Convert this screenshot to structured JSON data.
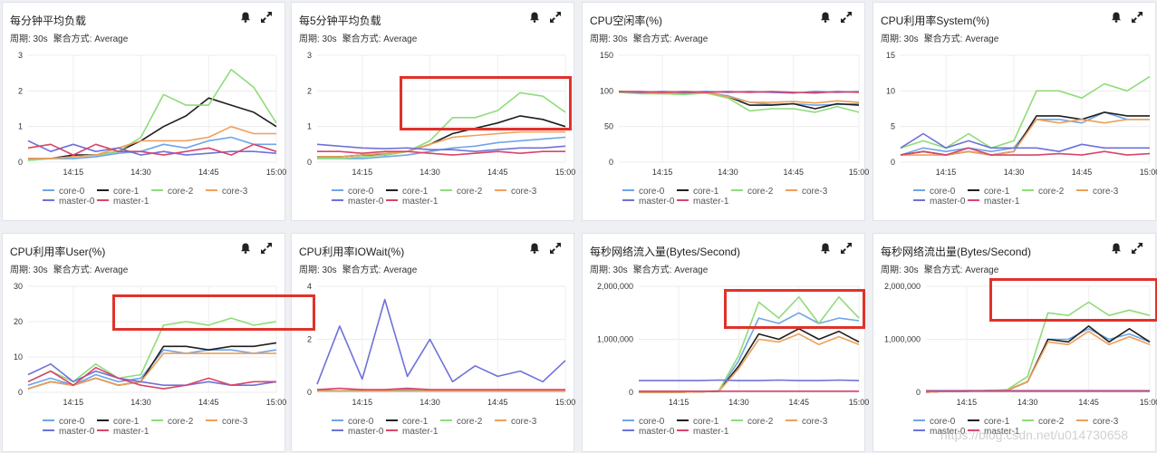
{
  "legend": [
    {
      "name": "core-0",
      "color": "#6fa5e8"
    },
    {
      "name": "core-1",
      "color": "#1f1f1f"
    },
    {
      "name": "core-2",
      "color": "#8fdc7a"
    },
    {
      "name": "core-3",
      "color": "#eea05a"
    },
    {
      "name": "master-0",
      "color": "#6e72d8"
    },
    {
      "name": "master-1",
      "color": "#d8456a"
    }
  ],
  "panels": [
    {
      "title": "每分钟平均负载",
      "period": "周期: 30s",
      "agg": "聚合方式: Average"
    },
    {
      "title": "每5分钟平均负载",
      "period": "周期: 30s",
      "agg": "聚合方式: Average"
    },
    {
      "title": "CPU空闲率(%)",
      "period": "周期: 30s",
      "agg": "聚合方式: Average"
    },
    {
      "title": "CPU利用率System(%)",
      "period": "周期: 30s",
      "agg": "聚合方式: Average"
    },
    {
      "title": "CPU利用率User(%)",
      "period": "周期: 30s",
      "agg": "聚合方式: Average"
    },
    {
      "title": "CPU利用率IOWait(%)",
      "period": "周期: 30s",
      "agg": "聚合方式: Average"
    },
    {
      "title": "每秒网络流入量(Bytes/Second)",
      "period": "周期: 30s",
      "agg": "聚合方式: Average"
    },
    {
      "title": "每秒网络流出量(Bytes/Second)",
      "period": "周期: 30s",
      "agg": "聚合方式: Average"
    }
  ],
  "chart_data": [
    {
      "type": "line",
      "x": [
        "14:05",
        "14:10",
        "14:15",
        "14:20",
        "14:25",
        "14:30",
        "14:35",
        "14:40",
        "14:45",
        "14:50",
        "14:55",
        "15:00"
      ],
      "xticks": [
        "14:15",
        "14:30",
        "14:45",
        "15:00"
      ],
      "yticks": [
        "0",
        "1",
        "2",
        "3"
      ],
      "ylim": [
        0,
        3
      ],
      "series": [
        {
          "name": "core-0",
          "values": [
            0.05,
            0.1,
            0.1,
            0.15,
            0.25,
            0.3,
            0.5,
            0.4,
            0.6,
            0.7,
            0.5,
            0.5
          ]
        },
        {
          "name": "core-1",
          "values": [
            0.1,
            0.1,
            0.2,
            0.2,
            0.3,
            0.6,
            1.0,
            1.3,
            1.8,
            1.6,
            1.4,
            1.0
          ]
        },
        {
          "name": "core-2",
          "values": [
            0.05,
            0.1,
            0.15,
            0.2,
            0.3,
            0.7,
            1.9,
            1.6,
            1.6,
            2.6,
            2.1,
            1.1
          ]
        },
        {
          "name": "core-3",
          "values": [
            0.1,
            0.1,
            0.15,
            0.2,
            0.4,
            0.6,
            0.6,
            0.6,
            0.7,
            1.0,
            0.8,
            0.8
          ]
        },
        {
          "name": "master-0",
          "values": [
            0.6,
            0.3,
            0.5,
            0.3,
            0.4,
            0.2,
            0.3,
            0.2,
            0.25,
            0.3,
            0.3,
            0.25
          ]
        },
        {
          "name": "master-1",
          "values": [
            0.4,
            0.5,
            0.2,
            0.5,
            0.3,
            0.3,
            0.2,
            0.3,
            0.4,
            0.2,
            0.5,
            0.3
          ]
        }
      ]
    },
    {
      "type": "line",
      "x": [
        "14:05",
        "14:10",
        "14:15",
        "14:20",
        "14:25",
        "14:30",
        "14:35",
        "14:40",
        "14:45",
        "14:50",
        "14:55",
        "15:00"
      ],
      "xticks": [
        "14:15",
        "14:30",
        "14:45",
        "15:00"
      ],
      "yticks": [
        "0",
        "1",
        "2",
        "3"
      ],
      "ylim": [
        0,
        3
      ],
      "series": [
        {
          "name": "core-0",
          "values": [
            0.1,
            0.1,
            0.1,
            0.15,
            0.2,
            0.3,
            0.4,
            0.45,
            0.55,
            0.6,
            0.65,
            0.7
          ]
        },
        {
          "name": "core-1",
          "values": [
            0.15,
            0.15,
            0.2,
            0.2,
            0.3,
            0.5,
            0.8,
            0.95,
            1.1,
            1.3,
            1.2,
            1.0
          ]
        },
        {
          "name": "core-2",
          "values": [
            0.1,
            0.1,
            0.15,
            0.2,
            0.3,
            0.6,
            1.25,
            1.25,
            1.45,
            1.95,
            1.85,
            1.4
          ]
        },
        {
          "name": "core-3",
          "values": [
            0.15,
            0.15,
            0.2,
            0.25,
            0.3,
            0.5,
            0.7,
            0.75,
            0.8,
            0.85,
            0.85,
            0.85
          ]
        },
        {
          "name": "master-0",
          "values": [
            0.5,
            0.45,
            0.4,
            0.38,
            0.4,
            0.35,
            0.35,
            0.3,
            0.35,
            0.4,
            0.4,
            0.45
          ]
        },
        {
          "name": "master-1",
          "values": [
            0.3,
            0.3,
            0.25,
            0.3,
            0.3,
            0.25,
            0.2,
            0.25,
            0.3,
            0.25,
            0.3,
            0.3
          ]
        }
      ]
    },
    {
      "type": "line",
      "x": [
        "14:05",
        "14:10",
        "14:15",
        "14:20",
        "14:25",
        "14:30",
        "14:35",
        "14:40",
        "14:45",
        "14:50",
        "14:55",
        "15:00"
      ],
      "xticks": [
        "14:15",
        "14:30",
        "14:45",
        "15:00"
      ],
      "yticks": [
        "0",
        "50",
        "100",
        "150"
      ],
      "ylim": [
        0,
        150
      ],
      "series": [
        {
          "name": "core-0",
          "values": [
            98,
            97,
            96,
            97,
            98,
            93,
            84,
            81,
            82,
            80,
            81,
            82
          ]
        },
        {
          "name": "core-1",
          "values": [
            99,
            98,
            97,
            98,
            97,
            92,
            80,
            80,
            82,
            75,
            82,
            80
          ]
        },
        {
          "name": "core-2",
          "values": [
            98,
            96,
            96,
            95,
            97,
            90,
            72,
            75,
            75,
            70,
            78,
            70
          ]
        },
        {
          "name": "core-3",
          "values": [
            99,
            98,
            97,
            98,
            98,
            92,
            84,
            84,
            85,
            83,
            86,
            84
          ]
        },
        {
          "name": "master-0",
          "values": [
            99,
            98,
            99,
            98,
            99,
            98,
            99,
            98,
            97,
            99,
            98,
            99
          ]
        },
        {
          "name": "master-1",
          "values": [
            99,
            99,
            98,
            99,
            98,
            99,
            98,
            99,
            98,
            97,
            99,
            98
          ]
        }
      ]
    },
    {
      "type": "line",
      "x": [
        "14:05",
        "14:10",
        "14:15",
        "14:20",
        "14:25",
        "14:30",
        "14:35",
        "14:40",
        "14:45",
        "14:50",
        "14:55",
        "15:00"
      ],
      "xticks": [
        "14:15",
        "14:30",
        "14:45",
        "15:00"
      ],
      "yticks": [
        "0",
        "5",
        "10",
        "15"
      ],
      "ylim": [
        0,
        15
      ],
      "series": [
        {
          "name": "core-0",
          "values": [
            1,
            2,
            1.5,
            2,
            1.5,
            2,
            6,
            6,
            5.5,
            7,
            6,
            6
          ]
        },
        {
          "name": "core-1",
          "values": [
            1,
            1.5,
            1,
            1.5,
            1,
            1.5,
            6.5,
            6.5,
            6,
            7,
            6.5,
            6.5
          ]
        },
        {
          "name": "core-2",
          "values": [
            2,
            3,
            2,
            4,
            2,
            3,
            10,
            10,
            9,
            11,
            10,
            12
          ]
        },
        {
          "name": "core-3",
          "values": [
            1,
            1,
            1,
            1.5,
            1,
            1.5,
            6,
            5.5,
            6,
            5.5,
            6,
            6
          ]
        },
        {
          "name": "master-0",
          "values": [
            2,
            4,
            2,
            3,
            2,
            2,
            2,
            1.5,
            2.5,
            2,
            2,
            2
          ]
        },
        {
          "name": "master-1",
          "values": [
            1,
            1.5,
            1,
            2,
            1,
            1,
            1,
            1.2,
            1,
            1.5,
            1,
            1.2
          ]
        }
      ]
    },
    {
      "type": "line",
      "x": [
        "14:05",
        "14:10",
        "14:15",
        "14:20",
        "14:25",
        "14:30",
        "14:35",
        "14:40",
        "14:45",
        "14:50",
        "14:55",
        "15:00"
      ],
      "xticks": [
        "14:15",
        "14:30",
        "14:45",
        "15:00"
      ],
      "yticks": [
        "0",
        "10",
        "20",
        "30"
      ],
      "ylim": [
        0,
        30
      ],
      "series": [
        {
          "name": "core-0",
          "values": [
            2,
            4,
            2,
            5,
            3,
            4,
            12,
            11,
            12,
            12,
            11,
            12
          ]
        },
        {
          "name": "core-1",
          "values": [
            1,
            3,
            2,
            4,
            2,
            3,
            13,
            13,
            12,
            13,
            13,
            14
          ]
        },
        {
          "name": "core-2",
          "values": [
            3,
            6,
            3,
            8,
            4,
            5,
            19,
            20,
            19,
            21,
            19,
            20
          ]
        },
        {
          "name": "core-3",
          "values": [
            1,
            3,
            2,
            4,
            2,
            3,
            11,
            11,
            11,
            11,
            11,
            11
          ]
        },
        {
          "name": "master-0",
          "values": [
            5,
            8,
            3,
            6,
            4,
            3,
            2,
            2,
            3,
            2,
            2,
            3
          ]
        },
        {
          "name": "master-1",
          "values": [
            3,
            6,
            2,
            7,
            4,
            2,
            1,
            2,
            4,
            2,
            3,
            3
          ]
        }
      ]
    },
    {
      "type": "line",
      "x": [
        "14:05",
        "14:10",
        "14:15",
        "14:20",
        "14:25",
        "14:30",
        "14:35",
        "14:40",
        "14:45",
        "14:50",
        "14:55",
        "15:00"
      ],
      "xticks": [
        "14:15",
        "14:30",
        "14:45",
        "15:00"
      ],
      "yticks": [
        "0",
        "2",
        "4"
      ],
      "ylim": [
        0,
        4
      ],
      "series": [
        {
          "name": "core-0",
          "values": [
            0.1,
            0.05,
            0.1,
            0.05,
            0.1,
            0.05,
            0.05,
            0.05,
            0.05,
            0.05,
            0.05,
            0.05
          ]
        },
        {
          "name": "core-1",
          "values": [
            0.05,
            0.05,
            0.05,
            0.05,
            0.05,
            0.05,
            0.05,
            0.05,
            0.05,
            0.05,
            0.05,
            0.05
          ]
        },
        {
          "name": "core-2",
          "values": [
            0.05,
            0.05,
            0.05,
            0.05,
            0.05,
            0.05,
            0.05,
            0.05,
            0.05,
            0.05,
            0.05,
            0.05
          ]
        },
        {
          "name": "core-3",
          "values": [
            0.05,
            0.05,
            0.05,
            0.05,
            0.05,
            0.05,
            0.05,
            0.05,
            0.05,
            0.05,
            0.05,
            0.05
          ]
        },
        {
          "name": "master-0",
          "values": [
            0.3,
            2.5,
            0.5,
            3.5,
            0.6,
            2.0,
            0.4,
            1.0,
            0.6,
            0.8,
            0.4,
            1.2
          ]
        },
        {
          "name": "master-1",
          "values": [
            0.1,
            0.15,
            0.1,
            0.1,
            0.15,
            0.1,
            0.1,
            0.1,
            0.1,
            0.1,
            0.1,
            0.1
          ]
        }
      ]
    },
    {
      "type": "line",
      "x": [
        "14:05",
        "14:10",
        "14:15",
        "14:20",
        "14:25",
        "14:30",
        "14:35",
        "14:40",
        "14:45",
        "14:50",
        "14:55",
        "15:00"
      ],
      "xticks": [
        "14:15",
        "14:30",
        "14:45",
        "15:00"
      ],
      "yticks": [
        "0",
        "1,000,000",
        "2,000,000"
      ],
      "ylim": [
        0,
        2000000
      ],
      "series": [
        {
          "name": "core-0",
          "values": [
            0,
            0,
            0,
            10000,
            20000,
            600000,
            1400000,
            1300000,
            1500000,
            1300000,
            1400000,
            1350000
          ]
        },
        {
          "name": "core-1",
          "values": [
            0,
            0,
            0,
            10000,
            20000,
            500000,
            1100000,
            1000000,
            1200000,
            1000000,
            1150000,
            950000
          ]
        },
        {
          "name": "core-2",
          "values": [
            0,
            0,
            0,
            10000,
            30000,
            700000,
            1700000,
            1400000,
            1800000,
            1300000,
            1800000,
            1400000
          ]
        },
        {
          "name": "core-3",
          "values": [
            0,
            0,
            0,
            10000,
            20000,
            450000,
            1000000,
            950000,
            1100000,
            900000,
            1050000,
            900000
          ]
        },
        {
          "name": "master-0",
          "values": [
            220000,
            220000,
            220000,
            220000,
            230000,
            220000,
            220000,
            230000,
            220000,
            220000,
            230000,
            220000
          ]
        },
        {
          "name": "master-1",
          "values": [
            20000,
            20000,
            20000,
            20000,
            20000,
            20000,
            20000,
            20000,
            20000,
            20000,
            20000,
            20000
          ]
        }
      ]
    },
    {
      "type": "line",
      "x": [
        "14:05",
        "14:10",
        "14:15",
        "14:20",
        "14:25",
        "14:30",
        "14:35",
        "14:40",
        "14:45",
        "14:50",
        "14:55",
        "15:00"
      ],
      "xticks": [
        "14:15",
        "14:30",
        "14:45",
        "15:00"
      ],
      "yticks": [
        "0",
        "1,000,000",
        "2,000,000"
      ],
      "ylim": [
        0,
        2000000
      ],
      "series": [
        {
          "name": "core-0",
          "values": [
            0,
            20000,
            20000,
            30000,
            40000,
            200000,
            1000000,
            1000000,
            1200000,
            1000000,
            1100000,
            950000
          ]
        },
        {
          "name": "core-1",
          "values": [
            0,
            20000,
            20000,
            30000,
            40000,
            200000,
            1000000,
            950000,
            1250000,
            950000,
            1200000,
            950000
          ]
        },
        {
          "name": "core-2",
          "values": [
            0,
            20000,
            30000,
            30000,
            50000,
            300000,
            1500000,
            1450000,
            1700000,
            1450000,
            1550000,
            1450000
          ]
        },
        {
          "name": "core-3",
          "values": [
            0,
            20000,
            20000,
            30000,
            40000,
            200000,
            950000,
            900000,
            1150000,
            900000,
            1050000,
            900000
          ]
        },
        {
          "name": "master-0",
          "values": [
            30000,
            30000,
            30000,
            30000,
            30000,
            30000,
            30000,
            30000,
            30000,
            30000,
            30000,
            30000
          ]
        },
        {
          "name": "master-1",
          "values": [
            20000,
            20000,
            20000,
            20000,
            20000,
            20000,
            20000,
            20000,
            20000,
            20000,
            20000,
            20000
          ]
        }
      ]
    }
  ],
  "watermark": "https://blog.csdn.net/u014730658"
}
